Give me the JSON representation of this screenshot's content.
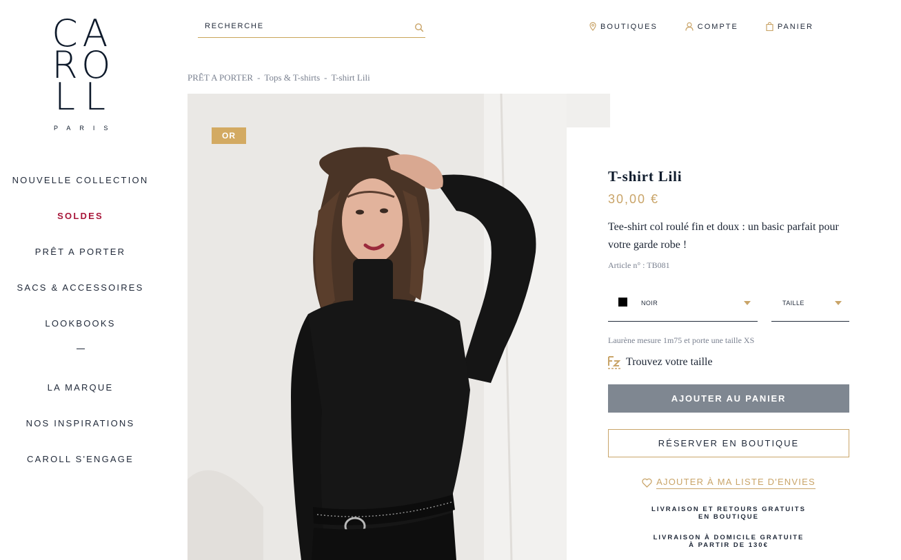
{
  "logo": {
    "rows": [
      "CA",
      "RO",
      "LL"
    ],
    "sub": "PARIS"
  },
  "sidenav": {
    "items": [
      {
        "label": "NOUVELLE COLLECTION"
      },
      {
        "label": "SOLDES"
      },
      {
        "label": "PRÊT A PORTER"
      },
      {
        "label": "SACS & ACCESSOIRES"
      },
      {
        "label": "LOOKBOOKS"
      },
      {
        "label": "LA MARQUE"
      },
      {
        "label": "NOS INSPIRATIONS"
      },
      {
        "label": "CAROLL S'ENGAGE"
      }
    ]
  },
  "header": {
    "search_placeholder": "RECHERCHE",
    "links": {
      "stores": "BOUTIQUES",
      "account": "COMPTE",
      "cart": "PANIER"
    }
  },
  "breadcrumb": {
    "items": [
      "PRÊT A PORTER",
      "Tops & T-shirts",
      "T-shirt Lili"
    ],
    "separator": "-"
  },
  "product": {
    "badge": "OR",
    "title": "T-shirt Lili",
    "price": "30,00 €",
    "description": "Tee-shirt col roulé fin et doux : un basic parfait pour votre garde robe !",
    "reference": "Article n° : TB081",
    "color": {
      "label": "NOIR",
      "swatch": "#000000"
    },
    "size": {
      "label": "TAILLE"
    },
    "model_info": "Laurène mesure 1m75 et porte une taille XS",
    "size_finder": "Trouvez votre taille",
    "add_to_cart": "AJOUTER AU PANIER",
    "reserve": "RÉSERVER EN BOUTIQUE",
    "wishlist": "AJOUTER À MA LISTE D'ENVIES",
    "shipping": {
      "line1a": "LIVRAISON ET RETOURS GRATUITS",
      "line1b": "EN BOUTIQUE",
      "line2a": "LIVRAISON À DOMICILE GRATUITE",
      "line2b": "À PARTIR DE 130€"
    }
  },
  "colors": {
    "accent_gold": "#c9a468",
    "sale_red": "#a8173a",
    "navy": "#0e1a2b",
    "button_grey": "#7f8791"
  }
}
